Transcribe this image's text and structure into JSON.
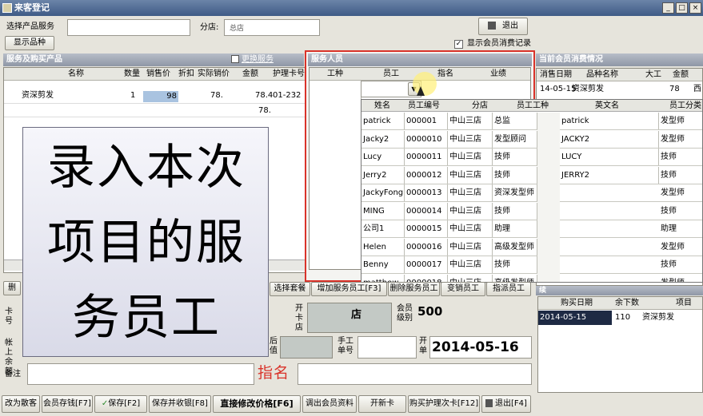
{
  "window": {
    "title": "来客登记",
    "min": "_",
    "max": "□",
    "close": "×"
  },
  "top": {
    "service_label": "选择产品服务",
    "branch_label": "分店:",
    "branch_value": "总店",
    "exit_label": "退出",
    "show_product_btn": "显示品种",
    "show_member_records": "显示会员消费记录"
  },
  "left_panel": {
    "section_title": "服务及购买产品",
    "change_service": "更换服务",
    "headers": [
      "名称",
      "数量",
      "销售价",
      "折扣",
      "实际销价",
      "金额",
      "护理卡号"
    ],
    "row": {
      "name": "资深剪发",
      "qty": "1",
      "price": "98",
      "discount": "",
      "actual": "78.",
      "amount": "78.4",
      "card": "01-232"
    },
    "total": "78."
  },
  "staff_panel": {
    "section_title": "服务人员",
    "headers": [
      "工种",
      "员工",
      "指名",
      "业绩"
    ],
    "dropdown_headers": [
      "姓名",
      "员工编号",
      "分店",
      "员工工种",
      "英文名",
      "员工分类"
    ],
    "employees": [
      {
        "name": "patrick",
        "id": "000001",
        "branch": "中山三店",
        "role": "总监",
        "en": "patrick",
        "cat": "发型师"
      },
      {
        "name": "Jacky2",
        "id": "0000010",
        "branch": "中山三店",
        "role": "发型顾问",
        "en": "JACKY2",
        "cat": "发型师"
      },
      {
        "name": "Lucy",
        "id": "0000011",
        "branch": "中山三店",
        "role": "技师",
        "en": "LUCY",
        "cat": "技师"
      },
      {
        "name": "Jerry2",
        "id": "0000012",
        "branch": "中山三店",
        "role": "技师",
        "en": "JERRY2",
        "cat": "技师"
      },
      {
        "name": "JackyFong",
        "id": "0000013",
        "branch": "中山三店",
        "role": "资深发型师",
        "en": "",
        "cat": "发型师"
      },
      {
        "name": "MING",
        "id": "0000014",
        "branch": "中山三店",
        "role": "技师",
        "en": "",
        "cat": "技师"
      },
      {
        "name": "公司1",
        "id": "0000015",
        "branch": "中山三店",
        "role": "助理",
        "en": "",
        "cat": "助理"
      },
      {
        "name": "Helen",
        "id": "0000016",
        "branch": "中山三店",
        "role": "高级发型师",
        "en": "",
        "cat": "发型师"
      },
      {
        "name": "Benny",
        "id": "0000017",
        "branch": "中山三店",
        "role": "技师",
        "en": "",
        "cat": "技师"
      },
      {
        "name": "matthew",
        "id": "0000018",
        "branch": "中山三店",
        "role": "高级发型师",
        "en": "",
        "cat": "发型师"
      }
    ]
  },
  "right_panel": {
    "section_title": "当前会员消费情况",
    "headers": [
      "消售日期",
      "品种名称",
      "大工",
      "金额"
    ],
    "row": {
      "date": "14-05-15",
      "product": "资深剪发",
      "staff": "",
      "amount": "78",
      "extra": "西"
    },
    "purchase_headers": [
      "购买日期",
      "余下数",
      "项目"
    ],
    "purchase_row": {
      "date": "2014-05-15",
      "remain": "110",
      "item": "资深剪发"
    },
    "small_title": "续"
  },
  "overlay": {
    "line1": "录入本次",
    "line2": "项目的服",
    "line3": "务员工"
  },
  "middle_buttons": {
    "left_stub": "删",
    "select_package": "选择套餐",
    "add_staff": "增加服务员工[F3]",
    "delete_staff": "删除服务员工",
    "change_staff": "变销员工",
    "dispatch_staff": "指派员工"
  },
  "form": {
    "card_label": "卡号",
    "open_store_label": "开卡店",
    "store_value": "店",
    "member_level_label": "会员级别",
    "member_level_value": "500",
    "account_label": "帐上余额",
    "after_label": "后值",
    "manual_label": "手工单号",
    "open_label": "开单",
    "date_value": "2014-05-16",
    "remark_label": "备注",
    "designate_text": "指名"
  },
  "bottom_buttons": [
    "改为散客",
    "会员存钱[F7]",
    "保存[F2]",
    "保存并收银[F8]",
    "直接修改价格[F6]",
    "调出会员资料",
    "开新卡",
    "购买护理次卡[F12]",
    "退出[F4]"
  ],
  "colors": {
    "highlight_box": "#d9332a",
    "section_bar": "#8f97a6",
    "designate_text": "#d9332a",
    "price_cell": "#a9c3e0",
    "selected_row": "#1e2a44"
  }
}
